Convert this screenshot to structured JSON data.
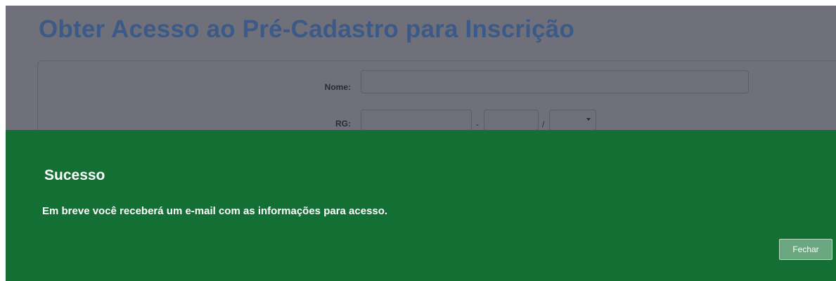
{
  "page": {
    "title": "Obter Acesso ao Pré-Cadastro para Inscrição"
  },
  "form": {
    "name_label": "Nome:",
    "name_value": "",
    "rg_label": "RG:",
    "rg_number_value": "",
    "rg_separator_dash": "-",
    "rg_digit_value": "",
    "rg_separator_slash": "/",
    "rg_state_value": ""
  },
  "modal": {
    "title": "Sucesso",
    "message": "Em breve você receberá um e-mail com as informações para acesso.",
    "close_label": "Fechar",
    "background_color": "#136f34"
  },
  "colors": {
    "overlay": "#6f7079",
    "title": "#3c5a87"
  }
}
